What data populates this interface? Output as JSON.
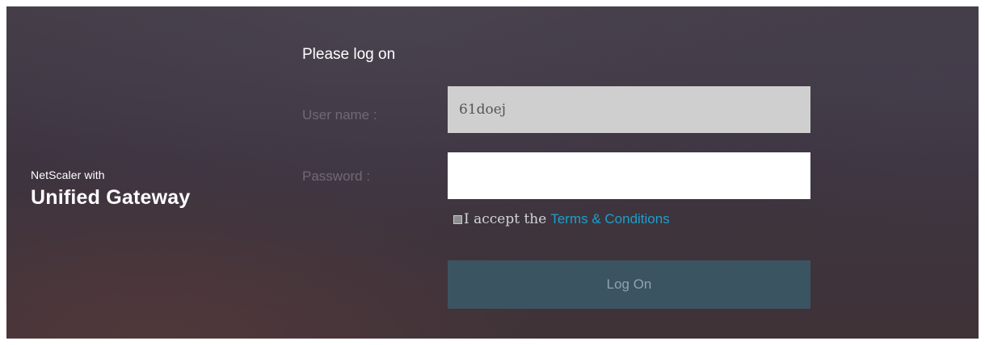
{
  "brand": {
    "subtitle": "NetScaler with",
    "title": "Unified Gateway"
  },
  "form": {
    "heading": "Please log on",
    "username_label": "User name :",
    "username_value": "61doej",
    "password_label": "Password :",
    "password_value": "",
    "terms_prefix": "I accept the",
    "terms_link": "Terms & Conditions",
    "terms_checked": false,
    "logon_label": "Log On"
  },
  "colors": {
    "background": "#3f3640",
    "accent_link": "#1d9fcb",
    "button_bg": "#3b5462",
    "username_bg": "#cfcfcf",
    "label_text": "#6f6a76"
  }
}
